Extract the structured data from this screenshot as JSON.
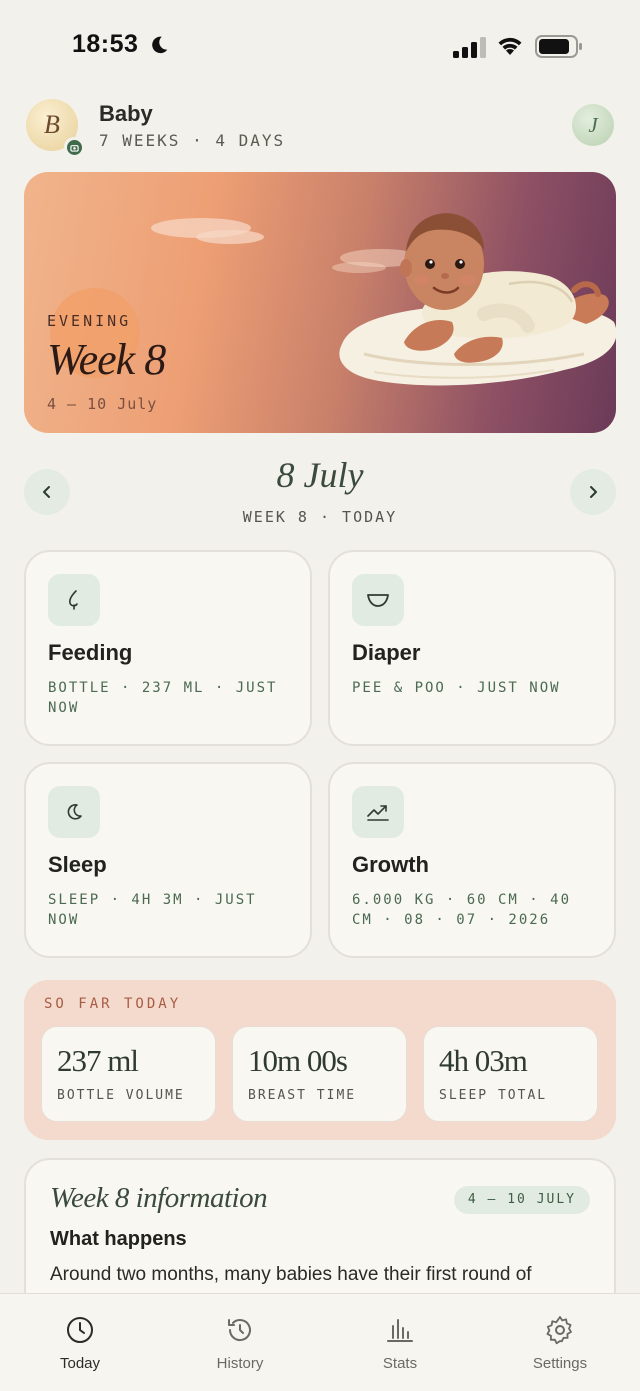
{
  "status_bar": {
    "time": "18:53",
    "icons": [
      "moon-icon",
      "signal-icon",
      "wifi-icon",
      "battery-icon"
    ]
  },
  "header": {
    "avatar_initial": "B",
    "baby_name": "Baby",
    "age": "7 WEEKS · 4 DAYS",
    "profile_initial": "J"
  },
  "hero": {
    "time_of_day": "EVENING",
    "week_title": "Week 8",
    "date_range": "4 – 10 July"
  },
  "date_nav": {
    "date": "8 July",
    "subtitle": "WEEK 8 · TODAY"
  },
  "log_cards": [
    {
      "title": "Feeding",
      "subtitle": "BOTTLE · 237 ML · JUST NOW",
      "icon": "feeding-icon"
    },
    {
      "title": "Diaper",
      "subtitle": "PEE & POO · JUST NOW",
      "icon": "diaper-icon"
    },
    {
      "title": "Sleep",
      "subtitle": "SLEEP · 4H 3M · JUST NOW",
      "icon": "moon-icon"
    },
    {
      "title": "Growth",
      "subtitle": "6.000 KG · 60 CM · 40 CM · 08 · 07 · 2026",
      "icon": "trend-icon"
    }
  ],
  "so_far_today": {
    "label": "SO FAR TODAY",
    "stats": [
      {
        "value": "237 ml",
        "label": "BOTTLE VOLUME"
      },
      {
        "value": "10m 00s",
        "label": "BREAST TIME"
      },
      {
        "value": "4h 03m",
        "label": "SLEEP TOTAL"
      }
    ]
  },
  "week_info": {
    "title": "Week 8 information",
    "badge": "4 – 10 JULY",
    "heading": "What happens",
    "text": "Around two months, many babies have their first round of"
  },
  "tabbar": {
    "tabs": [
      {
        "label": "Today",
        "icon": "clock-icon",
        "active": true
      },
      {
        "label": "History",
        "icon": "history-icon",
        "active": false
      },
      {
        "label": "Stats",
        "icon": "bar-chart-icon",
        "active": false
      },
      {
        "label": "Settings",
        "icon": "gear-icon",
        "active": false
      }
    ]
  },
  "colors": {
    "background": "#f3f1eb",
    "accent_green": "#3f6b4c",
    "card": "#f8f7f2",
    "summary_bg": "#f3dacd"
  }
}
